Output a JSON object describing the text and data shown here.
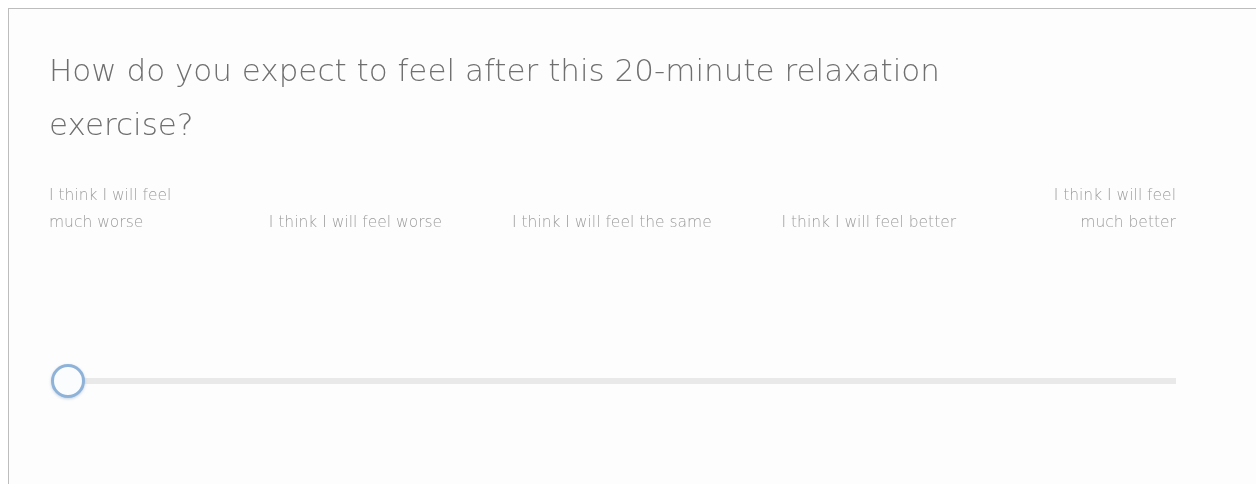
{
  "question": "How do you expect to feel after this 20-minute relaxation exercise?",
  "scale_labels": [
    "I think I will feel much worse",
    "I think I will feel worse",
    "I think I will feel the same",
    "I think I will feel better",
    "I think I will feel much better"
  ],
  "slider": {
    "level": 0
  }
}
